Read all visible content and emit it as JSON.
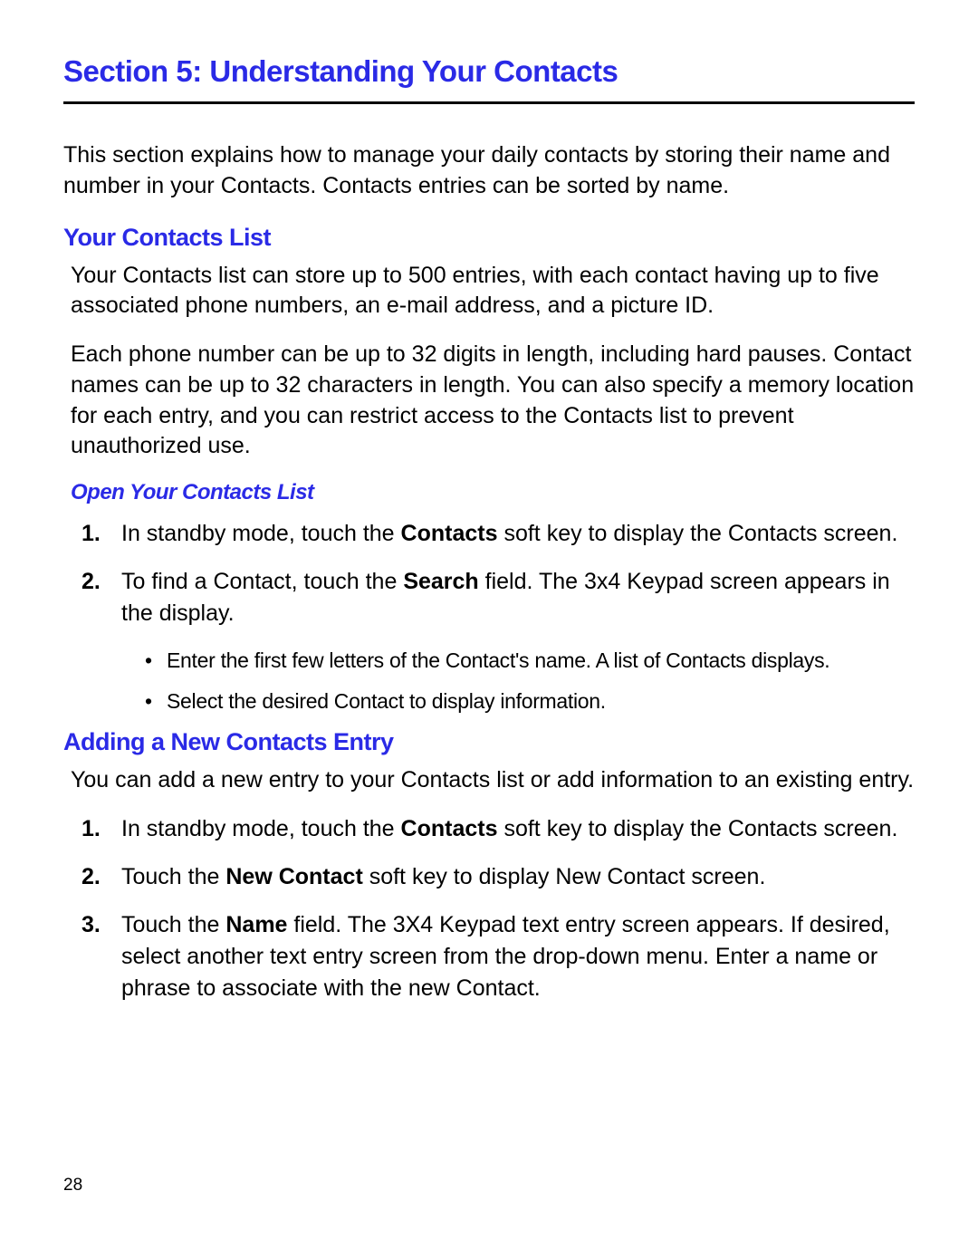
{
  "pageNumber": "28",
  "sectionTitle": "Section 5: Understanding Your Contacts",
  "intro": "This section explains how to manage your daily contacts by storing their name and number in your Contacts. Contacts entries can be sorted by name.",
  "h2a": "Your Contacts List",
  "p1": "Your Contacts list can store up to 500 entries, with each contact having up to five associated phone numbers, an e-mail address, and a picture ID.",
  "p2": "Each phone number can be up to 32 digits in length, including hard pauses. Contact names can be up to 32 characters in length. You can also specify a memory location for each entry, and you can restrict access to the Contacts list to prevent unauthorized use.",
  "h3a": "Open Your Contacts List",
  "stepsA": {
    "n1": "1.",
    "s1a": "In standby mode, touch the ",
    "s1b": "Contacts",
    "s1c": " soft key to display the Contacts screen.",
    "n2": "2.",
    "s2a": "To find a Contact, touch the ",
    "s2b": "Search",
    "s2c": " field. The 3x4 Keypad screen appears in the display."
  },
  "bulletsA": {
    "b1": "Enter the first few letters of the Contact's name. A list of Contacts displays.",
    "b2": "Select the desired Contact to display information."
  },
  "h2b": "Adding a New Contacts Entry",
  "p3": "You can add a new entry to your Contacts list or add information to an existing entry.",
  "stepsB": {
    "n1": "1.",
    "s1a": "In standby mode, touch the ",
    "s1b": "Contacts",
    "s1c": " soft key to display the Contacts screen.",
    "n2": "2.",
    "s2a": "Touch the ",
    "s2b": "New Contact",
    "s2c": " soft key to display New Contact screen.",
    "n3": "3.",
    "s3a": "Touch the ",
    "s3b": "Name",
    "s3c": " field. The 3X4 Keypad text entry screen appears. If desired, select another text entry screen from the drop-down menu. Enter a name or phrase to associate with the new Contact."
  }
}
